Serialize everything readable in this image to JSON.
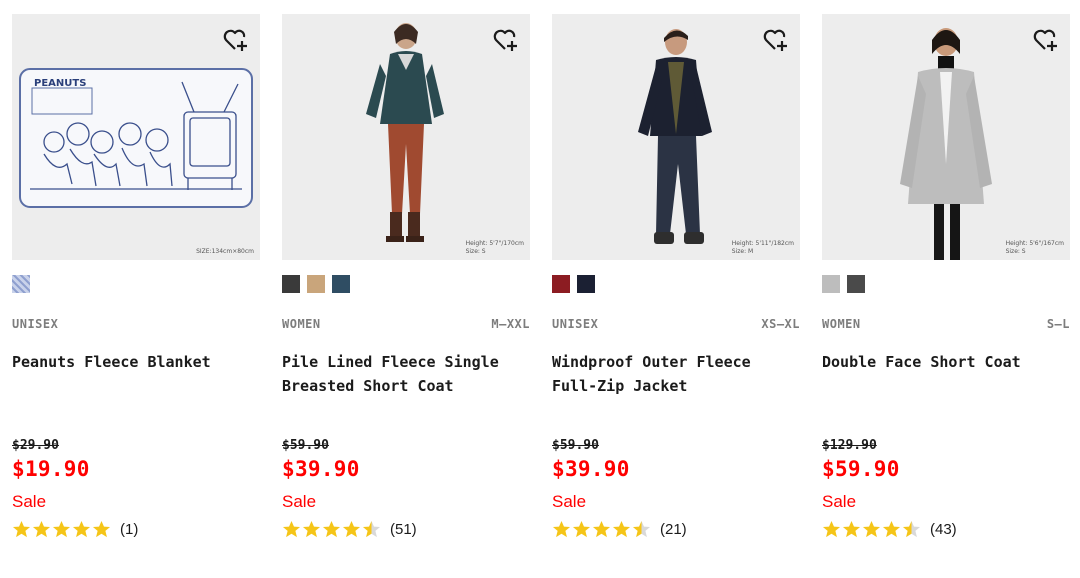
{
  "products": [
    {
      "gender": "UNISEX",
      "size": "",
      "name": "Peanuts Fleece Blanket",
      "original_price": "$29.90",
      "price": "$19.90",
      "sale_label": "Sale",
      "rating": 5,
      "rating_count": "(1)",
      "swatches": [
        "#b7c3de"
      ],
      "image_note": "SIZE:134cm×80cm",
      "image_logo": "PEANUTS"
    },
    {
      "gender": "WOMEN",
      "size": "M–XXL",
      "name": "Pile Lined Fleece Single Breasted Short Coat",
      "original_price": "$59.90",
      "price": "$39.90",
      "sale_label": "Sale",
      "rating": 4.5,
      "rating_count": "(51)",
      "swatches": [
        "#3a3a3a",
        "#c9a57b",
        "#2f4d63"
      ],
      "image_note": "Height: 5'7\"/170cm\nSize: S"
    },
    {
      "gender": "UNISEX",
      "size": "XS–XL",
      "name": "Windproof Outer Fleece Full-Zip Jacket",
      "original_price": "$59.90",
      "price": "$39.90",
      "sale_label": "Sale",
      "rating": 4.5,
      "rating_count": "(21)",
      "swatches": [
        "#8c1c22",
        "#1b2033"
      ],
      "image_note": "Height: 5'11\"/182cm\nSize: M"
    },
    {
      "gender": "WOMEN",
      "size": "S–L",
      "name": "Double Face Short Coat",
      "original_price": "$129.90",
      "price": "$59.90",
      "sale_label": "Sale",
      "rating": 4.5,
      "rating_count": "(43)",
      "swatches": [
        "#bdbdbd",
        "#4a4a4a"
      ],
      "image_note": "Height: 5'6\"/167cm\nSize: S"
    }
  ],
  "icons": {
    "favorite": "heart-plus-icon",
    "star": "star-icon"
  },
  "colors": {
    "sale_red": "#ff0000",
    "star_gold": "#f5c518",
    "text": "#1b1b1b",
    "muted": "#7d7d7d",
    "image_bg": "#ededed"
  }
}
